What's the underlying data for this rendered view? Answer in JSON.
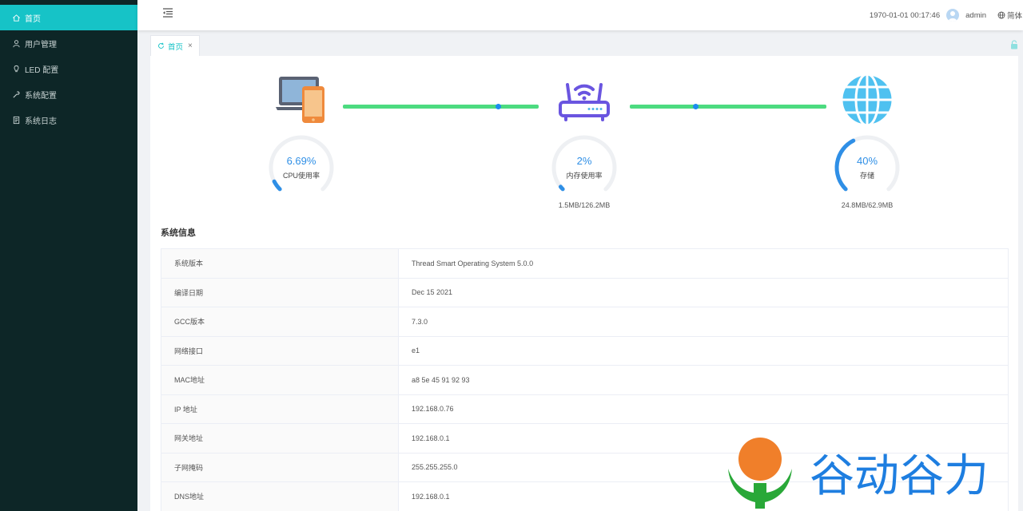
{
  "sidebar": {
    "items": [
      {
        "label": "首页",
        "icon": "home-icon",
        "active": true
      },
      {
        "label": "用户管理",
        "icon": "user-icon",
        "active": false
      },
      {
        "label": "LED 配置",
        "icon": "bulb-icon",
        "active": false
      },
      {
        "label": "系统配置",
        "icon": "wrench-icon",
        "active": false
      },
      {
        "label": "系统日志",
        "icon": "log-icon",
        "active": false
      }
    ]
  },
  "header": {
    "datetime": "1970-01-01 00:17:46",
    "user": "admin",
    "language": "简体"
  },
  "tabs": [
    {
      "label": "首页",
      "active": true
    }
  ],
  "dashboard": {
    "cpu": {
      "value": "6.69%",
      "label": "CPU使用率",
      "percent": 6.69
    },
    "memory": {
      "value": "2%",
      "label": "内存使用率",
      "detail": "1.5MB/126.2MB",
      "percent": 2
    },
    "storage": {
      "value": "40%",
      "label": "存储",
      "detail": "24.8MB/62.9MB",
      "percent": 40
    }
  },
  "system_info": {
    "title": "系统信息",
    "rows": [
      {
        "key": "系统版本",
        "value": "Thread Smart Operating System 5.0.0"
      },
      {
        "key": "编译日期",
        "value": "Dec 15 2021"
      },
      {
        "key": "GCC版本",
        "value": "7.3.0"
      },
      {
        "key": "网络接口",
        "value": "e1"
      },
      {
        "key": "MAC地址",
        "value": "a8 5e 45 91 92 93"
      },
      {
        "key": "IP 地址",
        "value": "192.168.0.76"
      },
      {
        "key": "网关地址",
        "value": "192.168.0.1"
      },
      {
        "key": "子网掩码",
        "value": "255.255.255.0"
      },
      {
        "key": "DNS地址",
        "value": "192.168.0.1"
      }
    ]
  },
  "watermark": {
    "text": "谷动谷力"
  },
  "colors": {
    "sidebar_bg": "#0d2627",
    "accent": "#16c3c7",
    "link_line": "#4cdb80",
    "gauge": "#2f8fe6"
  }
}
